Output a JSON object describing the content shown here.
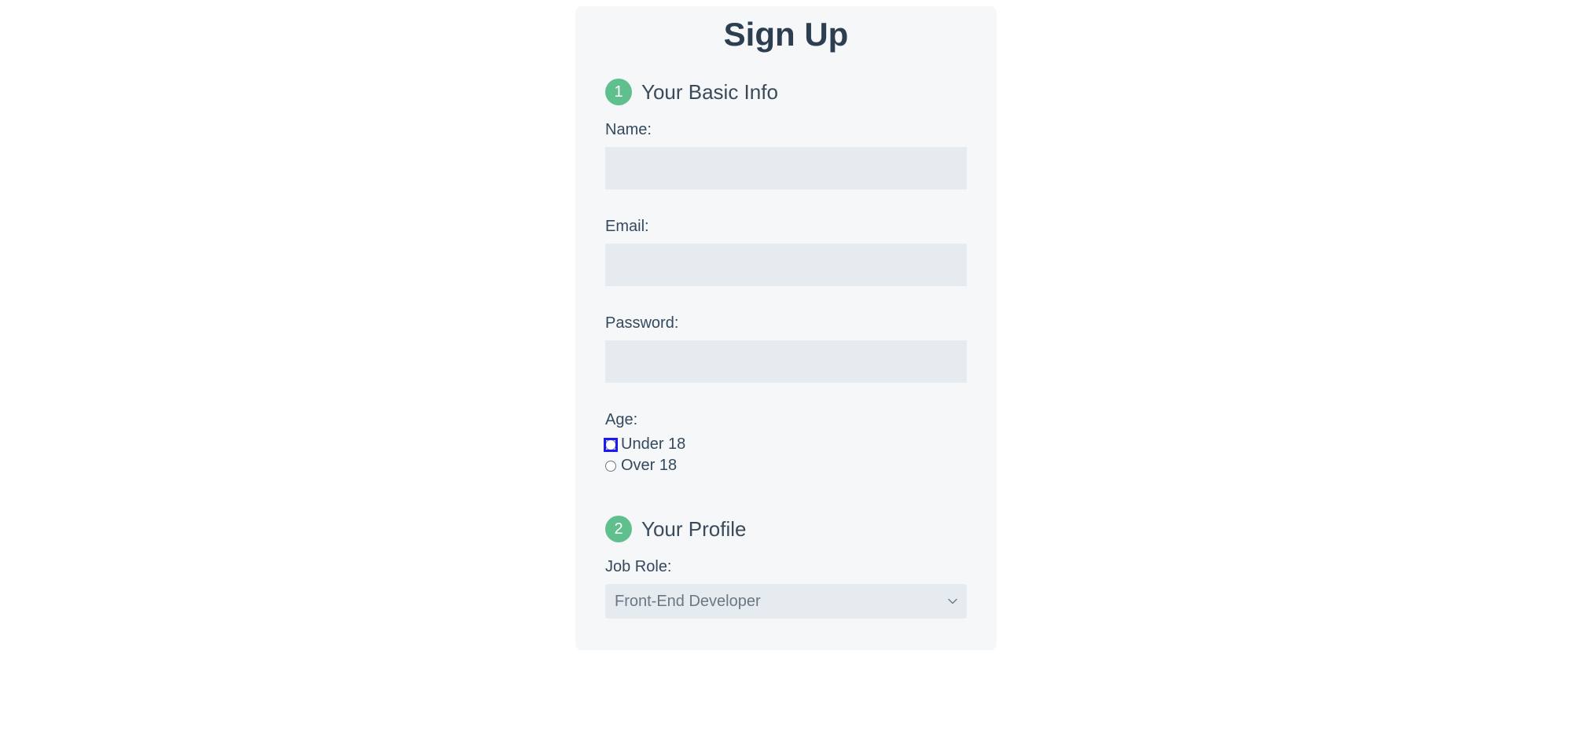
{
  "title": "Sign Up",
  "section1": {
    "step": "1",
    "heading": "Your Basic Info",
    "fields": {
      "name_label": "Name:",
      "name_value": "",
      "email_label": "Email:",
      "email_value": "",
      "password_label": "Password:",
      "password_value": "",
      "age_label": "Age:",
      "age_options": {
        "under_label": "Under 18",
        "over_label": "Over 18"
      }
    }
  },
  "section2": {
    "step": "2",
    "heading": "Your Profile",
    "fields": {
      "job_role_label": "Job Role:",
      "job_role_selected": "Front-End Developer"
    }
  }
}
